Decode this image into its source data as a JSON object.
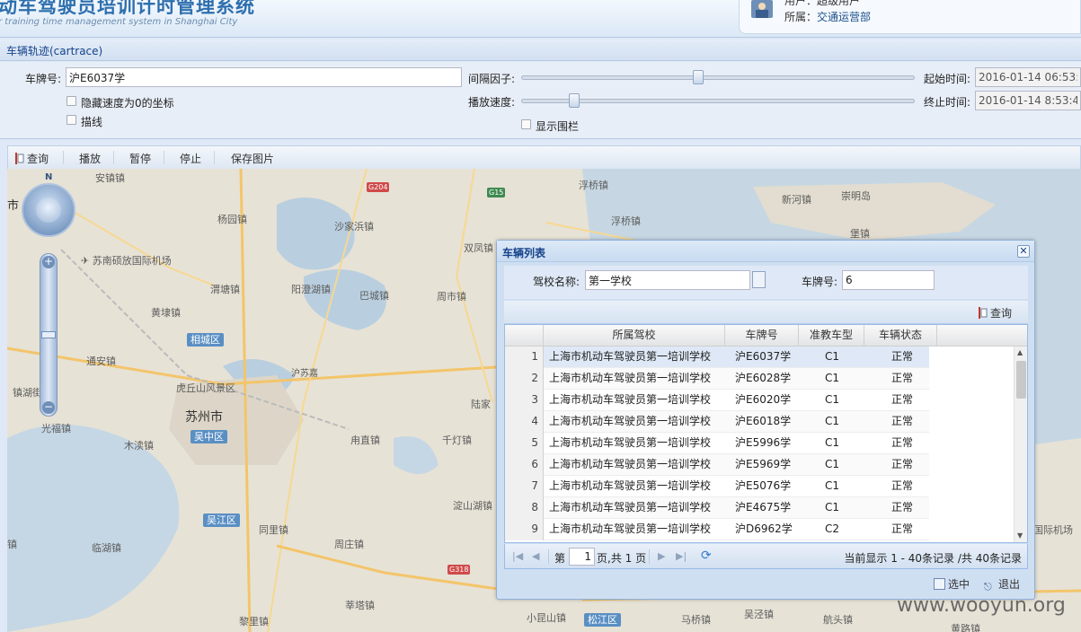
{
  "header": {
    "title": "动车驾驶员培训计时管理系统",
    "subtitle": "r training time management system in Shanghai City",
    "user_label": "用户：超级用户",
    "org_label": "所属：",
    "org_value": "交通运营部"
  },
  "panel": {
    "title": "车辆轨迹(cartrace)"
  },
  "filters": {
    "plate_label": "车牌号:",
    "plate_value": "沪E6037学",
    "hide_zero_speed_label": "隐藏速度为0的坐标",
    "trace_line_label": "描线",
    "interval_label": "间隔因子:",
    "playback_speed_label": "播放速度:",
    "show_fence_label": "显示围栏",
    "start_time_label": "起始时间:",
    "start_time_value": "2016-01-14 06:53:41",
    "end_time_label": "终止时间:",
    "end_time_value": "2016-01-14 8:53:41"
  },
  "toolbar": {
    "query": "查询",
    "play": "播放",
    "pause": "暂停",
    "stop": "停止",
    "save_image": "保存图片"
  },
  "map": {
    "places": {
      "shi": "市",
      "anqiao": "安镇镇",
      "yangyuan": "杨园镇",
      "shajiabang": "沙家浜镇",
      "fuqiao1": "浮桥镇",
      "fuqiao2": "浮桥镇",
      "xinhe": "新河镇",
      "chongming": "崇明岛",
      "bao": "堡镇",
      "shuangfeng": "双凤镇",
      "airport": "苏南硕放国际机场",
      "weitang": "渭塘镇",
      "yangcheng": "阳澄湖镇",
      "bacheng": "巴城镇",
      "zhoushi": "周市镇",
      "huangdai": "黄埭镇",
      "tongan": "通安镇",
      "zhenhu": "镇湖街",
      "huqiu": "虎丘山风景区",
      "suzhou": "苏州市",
      "mudu": "木渎镇",
      "guangfu": "光福镇",
      "yongzhi": "甪直镇",
      "qiandeng": "千灯镇",
      "lujia": "陆家",
      "tongli": "同里镇",
      "luzhi2": "周庄镇",
      "dianshanhu": "淀山湖镇",
      "linhu": "临湖镇",
      "zhen": "镇",
      "xinzhuang": "莘塔镇",
      "lili": "黎里镇",
      "xiaokunshan": "小昆山镇",
      "maqiao": "马桥镇",
      "wujing": "吴泾镇",
      "hangtou": "航头镇",
      "huangdu": "黄路镇",
      "intl_airport": "国际机场",
      "yangshan": "沪苏嘉"
    },
    "districts": {
      "xiangcheng": "相城区",
      "wuzhong": "吴中区",
      "wujiang": "吴江区",
      "songjiang": "松江区"
    },
    "roads": {
      "g204": "G204",
      "g15": "G15",
      "g318": "G318"
    },
    "compass": "N",
    "watermark": "www.wooyun.org"
  },
  "dialog": {
    "title": "车辆列表",
    "school_label": "驾校名称:",
    "school_value": "第一学校",
    "plate_label": "车牌号:",
    "plate_value": "6",
    "query": "查询",
    "columns": [
      "所属驾校",
      "车牌号",
      "准教车型",
      "车辆状态"
    ],
    "rows": [
      {
        "n": "1",
        "school": "上海市机动车驾驶员第一培训学校",
        "plate": "沪E6037学",
        "type": "C1",
        "status": "正常"
      },
      {
        "n": "2",
        "school": "上海市机动车驾驶员第一培训学校",
        "plate": "沪E6028学",
        "type": "C1",
        "status": "正常"
      },
      {
        "n": "3",
        "school": "上海市机动车驾驶员第一培训学校",
        "plate": "沪E6020学",
        "type": "C1",
        "status": "正常"
      },
      {
        "n": "4",
        "school": "上海市机动车驾驶员第一培训学校",
        "plate": "沪E6018学",
        "type": "C1",
        "status": "正常"
      },
      {
        "n": "5",
        "school": "上海市机动车驾驶员第一培训学校",
        "plate": "沪E5996学",
        "type": "C1",
        "status": "正常"
      },
      {
        "n": "6",
        "school": "上海市机动车驾驶员第一培训学校",
        "plate": "沪E5969学",
        "type": "C1",
        "status": "正常"
      },
      {
        "n": "7",
        "school": "上海市机动车驾驶员第一培训学校",
        "plate": "沪E5076学",
        "type": "C1",
        "status": "正常"
      },
      {
        "n": "8",
        "school": "上海市机动车驾驶员第一培训学校",
        "plate": "沪E4675学",
        "type": "C1",
        "status": "正常"
      },
      {
        "n": "9",
        "school": "上海市机动车驾驶员第一培训学校",
        "plate": "沪D6962学",
        "type": "C2",
        "status": "正常"
      }
    ],
    "pager": {
      "page_prefix": "第",
      "page_value": "1",
      "page_suffix": "页,共 1 页",
      "summary": "当前显示 1 - 40条记录 /共 40条记录"
    },
    "select": "选中",
    "exit": "退出"
  },
  "colors": {
    "accent": "#15428b",
    "panel_bg": "#dfe8f6",
    "border": "#99bbe8"
  }
}
